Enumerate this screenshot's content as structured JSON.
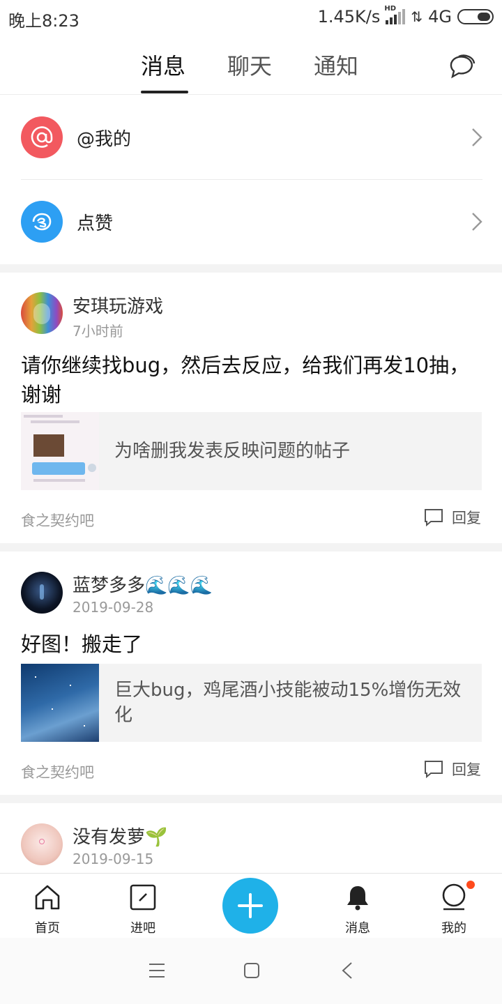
{
  "status_bar": {
    "time": "晚上8:23",
    "speed": "1.45K/s",
    "hd": "HD",
    "network": "4G"
  },
  "top_tabs": {
    "tabs": [
      {
        "label": "消息",
        "active": true
      },
      {
        "label": "聊天",
        "active": false
      },
      {
        "label": "通知",
        "active": false
      }
    ],
    "right_icon": "chat-bubbles-icon"
  },
  "quick_entries": [
    {
      "label": "@我的",
      "icon": "at-icon",
      "color": "#f2595f"
    },
    {
      "label": "点赞",
      "icon": "thumbs-up-icon",
      "color": "#2d9ff3"
    }
  ],
  "feed": [
    {
      "author": "安琪玩游戏",
      "time": "7小时前",
      "content": "请你继续找bug，然后去反应，给我们再发10抽，谢谢",
      "quote_text": "为啥删我发表反映问题的帖子",
      "forum": "食之契约吧",
      "reply_label": "回复"
    },
    {
      "author": "蓝梦多多🌊🌊🌊",
      "time": "2019-09-28",
      "content": "好图！搬走了",
      "quote_text": "巨大bug，鸡尾酒小技能被动15%增伤无效化",
      "forum": "食之契约吧",
      "reply_label": "回复"
    },
    {
      "author": "没有发萝🌱",
      "time": "2019-09-15"
    }
  ],
  "bottom_nav": {
    "items": [
      {
        "label": "首页",
        "icon": "home-icon"
      },
      {
        "label": "进吧",
        "icon": "enter-forum-icon"
      },
      {
        "label": "",
        "icon": "plus-icon"
      },
      {
        "label": "消息",
        "icon": "bell-icon"
      },
      {
        "label": "我的",
        "icon": "profile-icon",
        "badge": true
      }
    ]
  },
  "colors": {
    "accent": "#1fb1e8",
    "at_red": "#f2595f",
    "like_blue": "#2d9ff3",
    "badge": "#ff4a1c"
  }
}
